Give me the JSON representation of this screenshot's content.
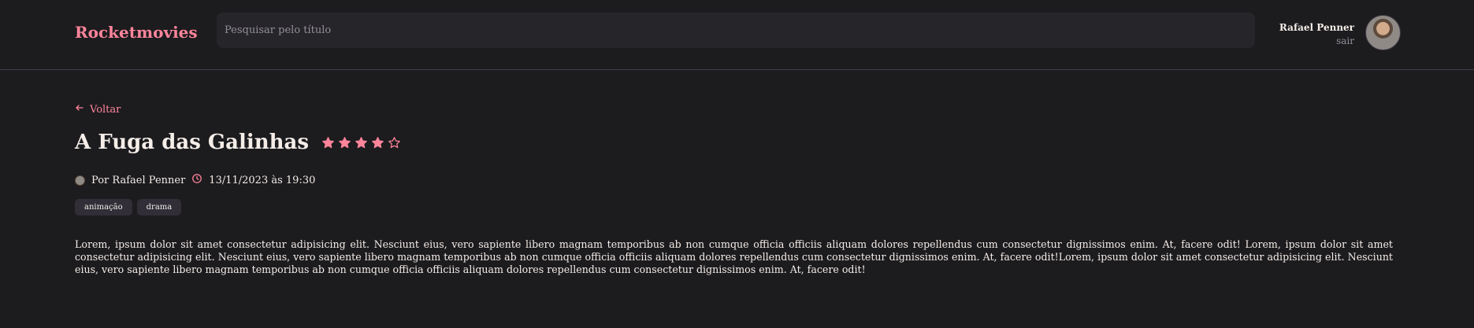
{
  "header": {
    "brand": "Rocketmovies",
    "search": {
      "placeholder": "Pesquisar pelo título",
      "value": ""
    },
    "user": {
      "name": "Rafael Penner",
      "logout": "sair"
    }
  },
  "movie": {
    "back_label": "Voltar",
    "title": "A Fuga das Galinhas",
    "rating": 4,
    "rating_max": 5,
    "author": "Por Rafael Penner",
    "created_at": "13/11/2023 às 19:30",
    "tags": [
      "animação",
      "drama"
    ],
    "description": "Lorem, ipsum dolor sit amet consectetur adipisicing elit. Nesciunt eius, vero sapiente libero magnam temporibus ab non cumque officia officiis aliquam dolores repellendus cum consectetur dignissimos enim. At, facere odit! Lorem, ipsum dolor sit amet consectetur adipisicing elit. Nesciunt eius, vero sapiente libero magnam temporibus ab non cumque officia officiis aliquam dolores repellendus cum consectetur dignissimos enim. At, facere odit!Lorem, ipsum dolor sit amet consectetur adipisicing elit. Nesciunt eius, vero sapiente libero magnam temporibus ab non cumque officia officiis aliquam dolores repellendus cum consectetur dignissimos enim. At, facere odit!"
  },
  "colors": {
    "accent": "#ff859b",
    "background": "#1c1b1e",
    "tag_bg": "#312e38"
  },
  "icons": {
    "back": "arrow-left-icon",
    "star": "star-icon",
    "clock": "clock-icon",
    "author": "avatar-icon"
  }
}
